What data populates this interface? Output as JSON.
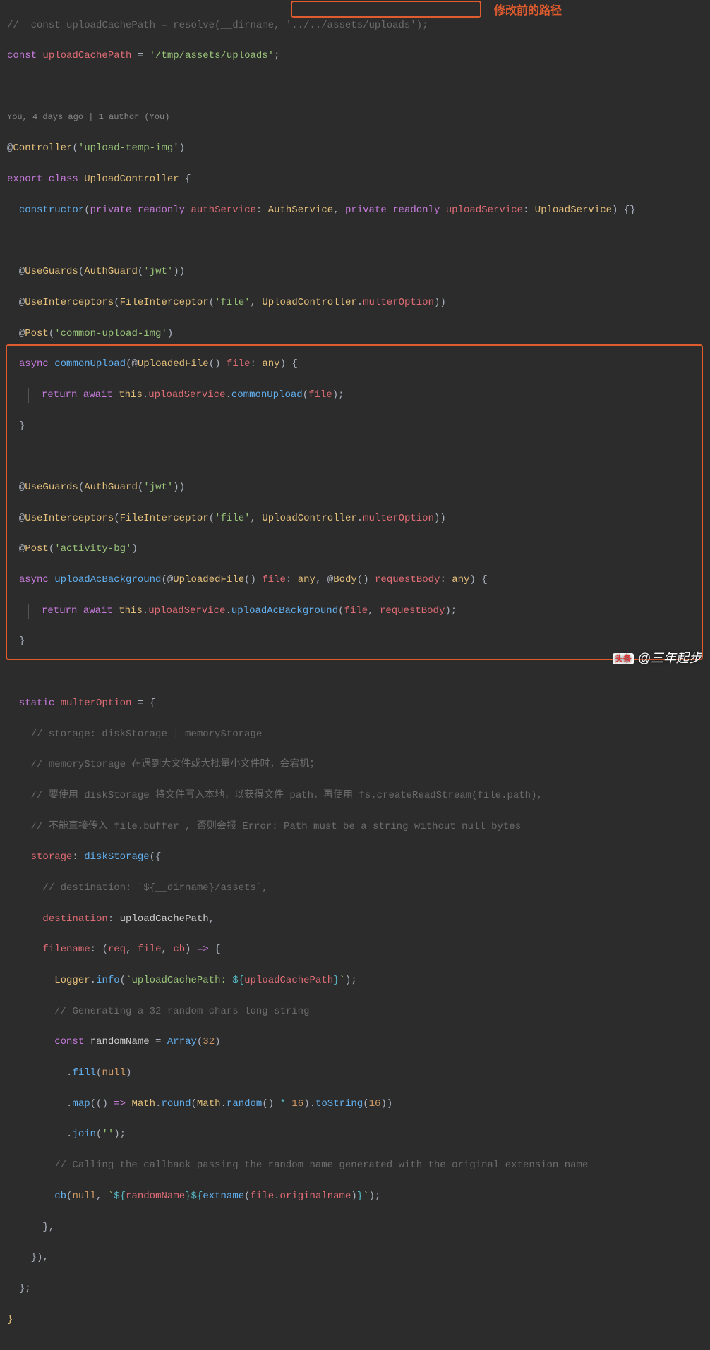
{
  "annotation": {
    "label": "修改前的路径"
  },
  "watermark": {
    "logo": "头条",
    "handle": "@三年起步"
  },
  "blame": "You, 4 days ago | 1 author (You)",
  "lines": {
    "l1": {
      "pre": "//  const uploadCachePath = resolve(__dirname, ",
      "hl": "'../../assets/uploads');"
    },
    "l2": {
      "kw": "const",
      "id": "uploadCachePath",
      "eq": " = ",
      "str": "'/tmp/assets/uploads'",
      "end": ";"
    },
    "l3": {
      "at": "@",
      "deco": "Controller",
      "p": "(",
      "str": "'upload-temp-img'",
      "q": ")"
    },
    "l4": {
      "kw": "export class",
      "cls": "UploadController",
      "b": " {"
    },
    "l5": {
      "kw": "constructor",
      "p": "(",
      "kw2": "private readonly",
      "id": "authService",
      "col": ": ",
      "ty": "AuthService",
      "c": ", ",
      "kw3": "private readonly",
      "id2": "uploadService",
      "col2": ": ",
      "ty2": "UploadService",
      "q": ") {}"
    },
    "l6": {
      "at": "@",
      "deco": "UseGuards",
      "p": "(",
      "cls": "AuthGuard",
      "p2": "(",
      "str": "'jwt'",
      "q": "))"
    },
    "l7": {
      "at": "@",
      "deco": "UseInterceptors",
      "p": "(",
      "cls": "FileInterceptor",
      "p2": "(",
      "str": "'file'",
      "c": ", ",
      "cls2": "UploadController",
      "dot": ".",
      "id": "multerOption",
      "q": "))"
    },
    "l8": {
      "at": "@",
      "deco": "Post",
      "p": "(",
      "str": "'common-upload-img'",
      "q": ")"
    },
    "l9": {
      "kw": "async",
      "fn": "commonUpload",
      "p": "(",
      "at": "@",
      "deco": "UploadedFile",
      "p2": "() ",
      "id": "file",
      "col": ": ",
      "ty": "any",
      "q": ") {"
    },
    "l10": {
      "kw": "return await",
      "this": "this",
      "d": ".",
      "id": "uploadService",
      "d2": ".",
      "fn": "commonUpload",
      "p": "(",
      "arg": "file",
      "q": ");"
    },
    "l11": {
      "b": "}"
    },
    "l12": {
      "at": "@",
      "deco": "UseGuards",
      "p": "(",
      "cls": "AuthGuard",
      "p2": "(",
      "str": "'jwt'",
      "q": "))"
    },
    "l13": {
      "at": "@",
      "deco": "UseInterceptors",
      "p": "(",
      "cls": "FileInterceptor",
      "p2": "(",
      "str": "'file'",
      "c": ", ",
      "cls2": "UploadController",
      "dot": ".",
      "id": "multerOption",
      "q": "))"
    },
    "l14": {
      "at": "@",
      "deco": "Post",
      "p": "(",
      "str": "'activity-bg'",
      "q": ")"
    },
    "l15": {
      "kw": "async",
      "fn": "uploadAcBackground",
      "p": "(",
      "at": "@",
      "deco": "UploadedFile",
      "p2": "() ",
      "id": "file",
      "col": ": ",
      "ty": "any",
      "c": ", ",
      "at2": "@",
      "deco2": "Body",
      "p3": "() ",
      "id2": "requestBody",
      "col2": ": ",
      "ty2": "any",
      "q": ") {"
    },
    "l16": {
      "kw": "return await",
      "this": "this",
      "d": ".",
      "id": "uploadService",
      "d2": ".",
      "fn": "uploadAcBackground",
      "p": "(",
      "arg": "file",
      "c": ", ",
      "arg2": "requestBody",
      "q": ");"
    },
    "l17": {
      "b": "}"
    },
    "l18": {
      "kw": "static",
      "id": "multerOption",
      "eq": " = {"
    },
    "c1": "// storage: diskStorage | memoryStorage",
    "c2": "// memoryStorage 在遇到大文件或大批量小文件时，会宕机；",
    "c3": "// 要使用 diskStorage 将文件写入本地，以获得文件 path，再使用 fs.createReadStream(file.path),",
    "c4": "// 不能直接传入 file.buffer , 否则会报 Error: Path must be a string without null bytes",
    "l19": {
      "id": "storage",
      "col": ": ",
      "fn": "diskStorage",
      "p": "({"
    },
    "c5": "// destination: `${__dirname}/assets`,",
    "l20": {
      "id": "destination",
      "col": ": ",
      "val": "uploadCachePath",
      "c": ","
    },
    "l21": {
      "id": "filename",
      "col": ": (",
      "a1": "req",
      "c1": ", ",
      "a2": "file",
      "c2": ", ",
      "a3": "cb",
      "q": ") ",
      "op": "=>",
      "b": " {"
    },
    "l22": {
      "cls": "Logger",
      "d": ".",
      "fn": "info",
      "p": "(",
      "bt": "`",
      "s1": "uploadCachePath: ",
      "dl": "${",
      "id": "uploadCachePath",
      "dr": "}",
      "bt2": "`",
      "q": ");"
    },
    "c6": "// Generating a 32 random chars long string",
    "l23": {
      "kw": "const",
      "id": "randomName",
      "eq": " = ",
      "fn": "Array",
      "p": "(",
      "num": "32",
      "q": ")"
    },
    "l24": {
      "d": ".",
      "fn": "fill",
      "p": "(",
      "n": "null",
      "q": ")"
    },
    "l25": {
      "d": ".",
      "fn": "map",
      "p": "(() ",
      "op": "=>",
      "sp": " ",
      "cls": "Math",
      "d2": ".",
      "fn2": "round",
      "p2": "(",
      "cls2": "Math",
      "d3": ".",
      "fn3": "random",
      "p3": "() ",
      "op2": "*",
      "sp2": " ",
      "num": "16",
      "q": ").",
      "fn4": "toString",
      "p4": "(",
      "num2": "16",
      "q2": "))"
    },
    "l26": {
      "d": ".",
      "fn": "join",
      "p": "(",
      "str": "''",
      "q": ");"
    },
    "c7": "// Calling the callback passing the random name generated with the original extension name",
    "l27": {
      "fn": "cb",
      "p": "(",
      "n": "null",
      "c": ", ",
      "bt": "`",
      "dl": "${",
      "id": "randomName",
      "dr": "}",
      "dl2": "${",
      "fn2": "extname",
      "p2": "(",
      "id2": "file",
      "d": ".",
      "id3": "originalname",
      "q": ")",
      "dr2": "}",
      "bt2": "`",
      "q2": ");"
    },
    "l28": "},",
    "l29": "}),",
    "l30": "};",
    "l31": "}"
  }
}
